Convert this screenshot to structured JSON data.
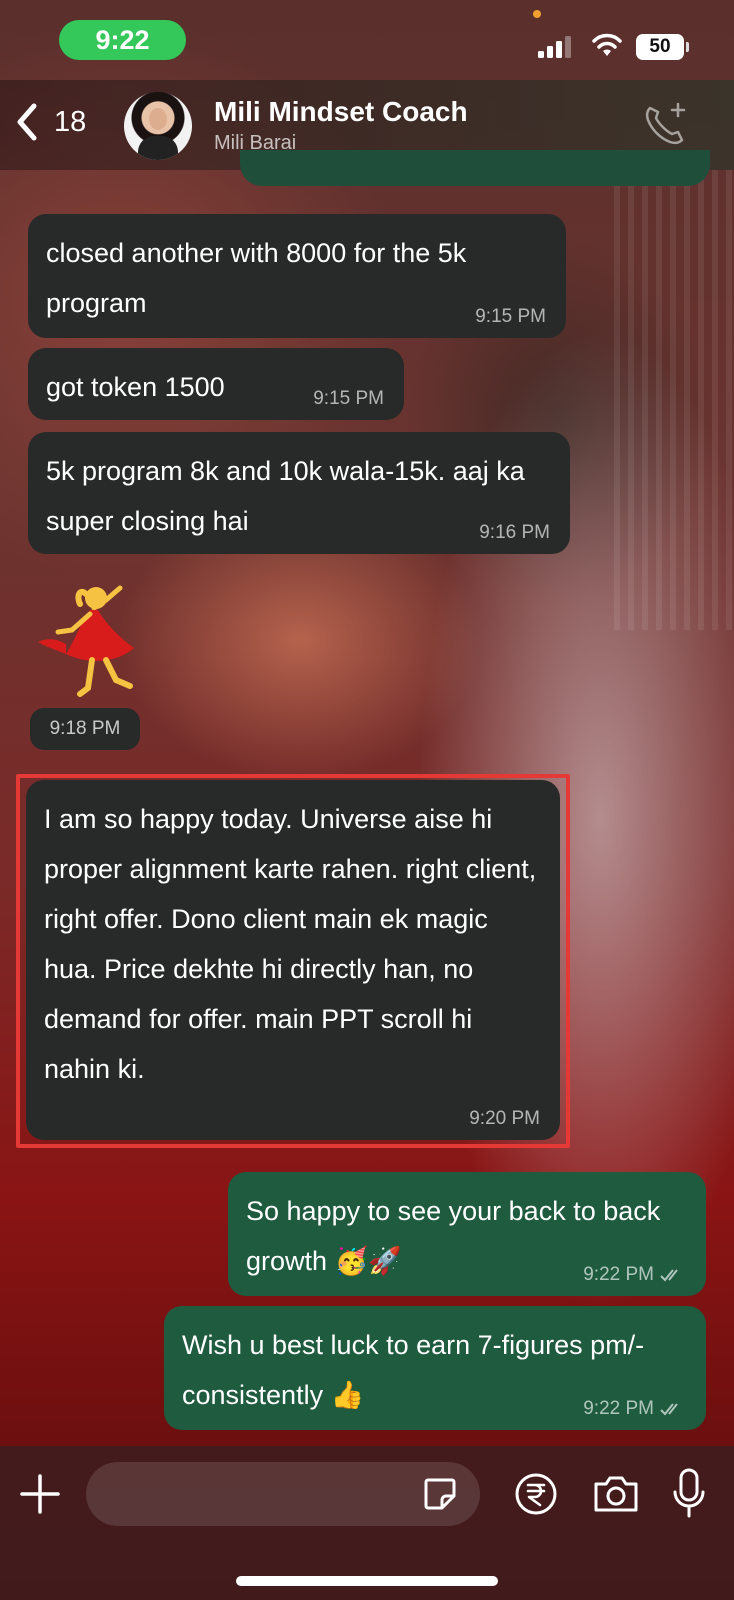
{
  "status_bar": {
    "time": "9:22",
    "battery": "50"
  },
  "header": {
    "back_count": "18",
    "contact_name": "Mili Mindset Coach",
    "contact_subtitle": "Mili Barai"
  },
  "messages": [
    {
      "direction": "incoming",
      "text": "closed another with 8000 for the 5k program",
      "time": "9:15 PM"
    },
    {
      "direction": "incoming",
      "text": "got token 1500",
      "time": "9:15 PM"
    },
    {
      "direction": "incoming",
      "text": "5k program 8k and 10k wala-15k. aaj ka super closing hai",
      "time": "9:16 PM"
    },
    {
      "direction": "incoming",
      "type": "emoji",
      "emoji": "dancer-emoji",
      "time": "9:18 PM"
    },
    {
      "direction": "incoming",
      "text": "I am so happy today. Universe aise hi proper alignment karte rahen. right client, right offer. Dono client main ek magic hua. Price dekhte hi directly han, no demand for offer. main PPT scroll hi nahin ki.",
      "time": "9:20 PM",
      "highlighted": true
    },
    {
      "direction": "outgoing",
      "text": "So happy to see your back to back growth 🥳🚀",
      "time": "9:22 PM",
      "status": "read"
    },
    {
      "direction": "outgoing",
      "text": "Wish u best luck to earn 7-figures pm/- consistently 👍",
      "time": "9:22 PM",
      "status": "read"
    }
  ],
  "composer": {
    "placeholder": ""
  },
  "colors": {
    "incoming_bubble": "#272a29",
    "outgoing_bubble": "#1e5b3f",
    "time_pill": "#34c759",
    "highlight": "#e53935"
  }
}
